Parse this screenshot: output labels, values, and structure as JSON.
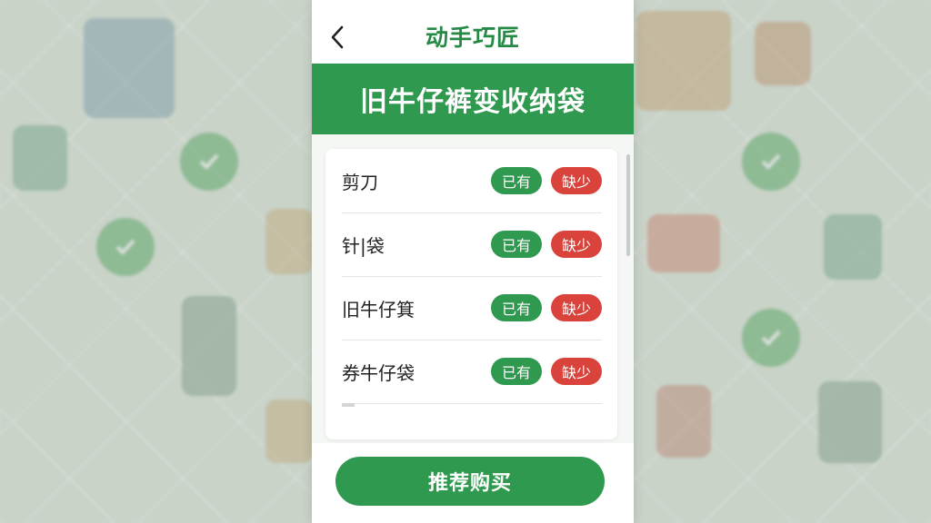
{
  "header": {
    "back_icon": "chevron-left-icon",
    "title": "动手巧匠"
  },
  "banner": {
    "title": "旧牛仔裤变收纳袋"
  },
  "checklist": {
    "items": [
      {
        "label": "剪刀",
        "have_label": "已有",
        "missing_label": "缺少"
      },
      {
        "label": "针|袋",
        "have_label": "已有",
        "missing_label": "缺少"
      },
      {
        "label": "旧牛仔箕",
        "have_label": "已有",
        "missing_label": "缺少"
      },
      {
        "label": "券牛仔袋",
        "have_label": "已有",
        "missing_label": "缺少"
      }
    ]
  },
  "footer": {
    "buy_label": "推荐购买"
  },
  "colors": {
    "accent_green": "#2f9a4f",
    "title_green": "#258a45",
    "missing_red": "#d9433c"
  }
}
